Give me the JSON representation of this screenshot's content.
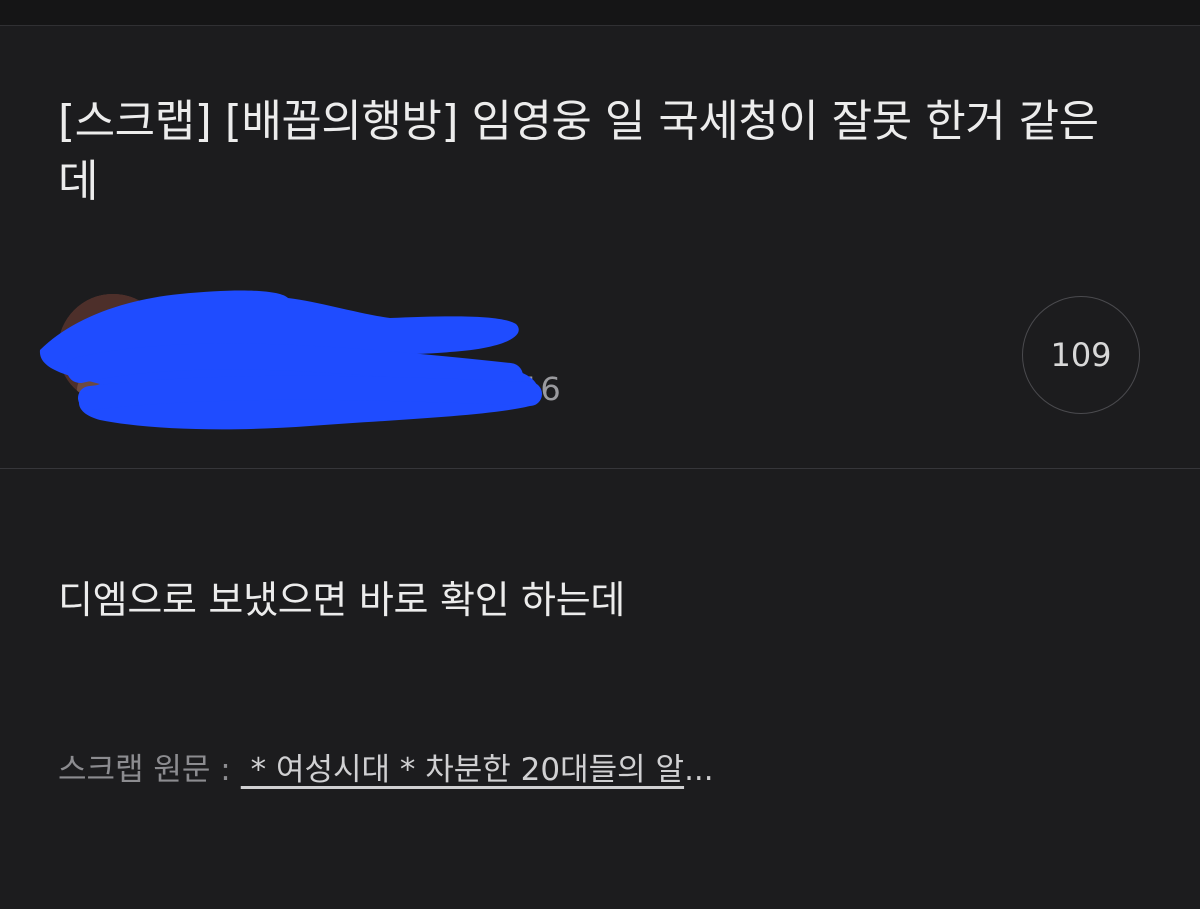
{
  "post": {
    "title": "[스크랩] [배꼽의행방] 임영웅 일 국세청이 잘못 한거 같은데",
    "body": "디엠으로 보냈으면 바로 확인 하는데"
  },
  "author": {
    "meta_visible": "16",
    "redaction_color": "#1f4cff"
  },
  "comments": {
    "count": "109"
  },
  "scrap": {
    "label": "스크랩 원문 :",
    "link_text": " * 여성시대 *  차분한 20대들의 알",
    "ellipsis": "..."
  },
  "icons": {
    "avatar": "profile-avatar"
  }
}
